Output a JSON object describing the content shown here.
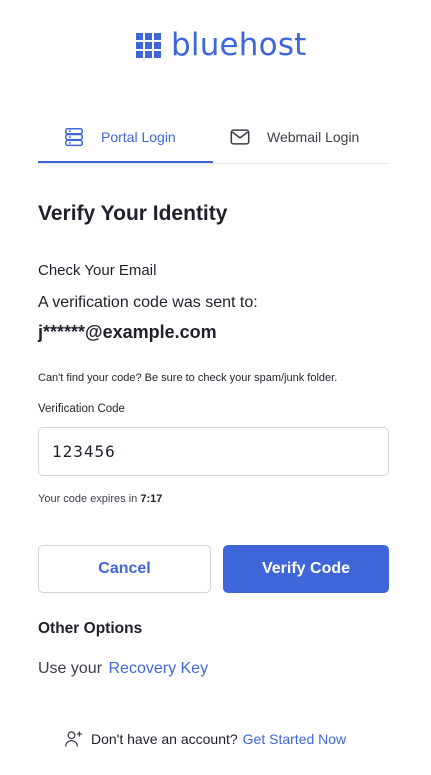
{
  "brand": {
    "name": "bluehost",
    "color": "#3f66d9"
  },
  "tabs": [
    {
      "label": "Portal Login",
      "icon": "server-icon",
      "active": true
    },
    {
      "label": "Webmail Login",
      "icon": "mail-icon",
      "active": false
    }
  ],
  "page": {
    "title": "Verify Your Identity",
    "subheading": "Check Your Email",
    "sent_text": "A verification code was sent to:",
    "email": "j******@example.com",
    "hint": "Can't find your code? Be sure to check your spam/junk folder."
  },
  "form": {
    "code_label": "Verification Code",
    "code_value": "123456",
    "expires_prefix": "Your code expires in",
    "expires_time": "7:17"
  },
  "buttons": {
    "cancel": "Cancel",
    "verify": "Verify Code"
  },
  "other_options": {
    "heading": "Other Options",
    "recovery_prefix": "Use your",
    "recovery_link": "Recovery Key"
  },
  "footer": {
    "icon": "add-user-icon",
    "text": "Don't have an account?",
    "link": "Get Started Now"
  }
}
